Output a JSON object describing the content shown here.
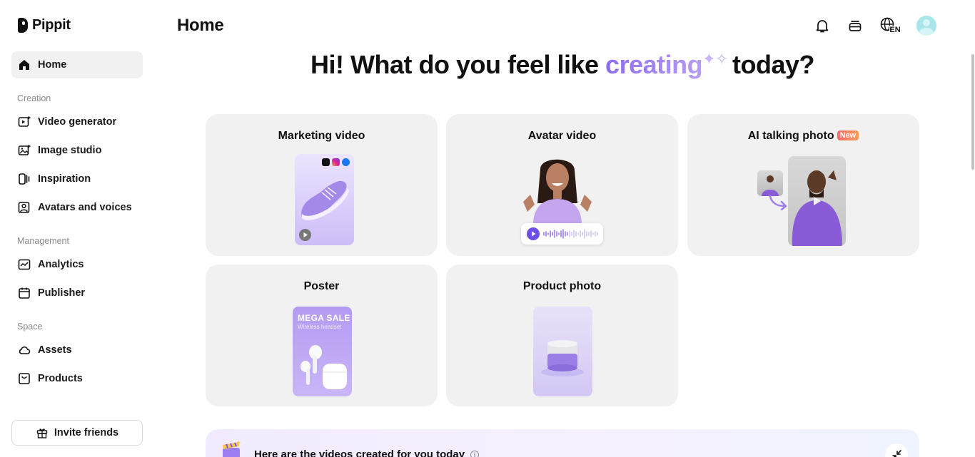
{
  "app": {
    "name": "Pippit"
  },
  "header": {
    "title": "Home",
    "language": "EN"
  },
  "sidebar": {
    "home_label": "Home",
    "sections": {
      "creation": "Creation",
      "management": "Management",
      "space": "Space"
    },
    "creation_items": [
      "Video generator",
      "Image studio",
      "Inspiration",
      "Avatars and voices"
    ],
    "management_items": [
      "Analytics",
      "Publisher"
    ],
    "space_items": [
      "Assets",
      "Products"
    ],
    "invite_label": "Invite friends"
  },
  "main": {
    "headline_pre": "Hi! What do you feel like ",
    "headline_highlight": "creating",
    "headline_post": "today?",
    "cards": [
      {
        "title": "Marketing video"
      },
      {
        "title": "Avatar video"
      },
      {
        "title": "AI talking photo",
        "badge": "New"
      },
      {
        "title": "Poster",
        "poster_title": "MEGA SALE",
        "poster_subtitle": "Wireless headset"
      },
      {
        "title": "Product photo"
      }
    ],
    "banner_text": "Here are the videos created for you today"
  },
  "colors": {
    "accent": "#8d6bf2",
    "card_bg": "#f1f1f1",
    "badge": "#ff6b6b"
  }
}
